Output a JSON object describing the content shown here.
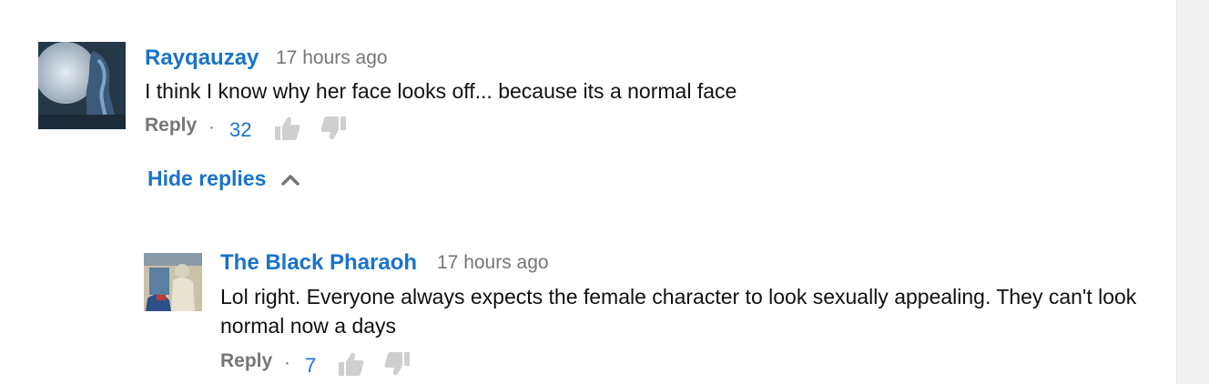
{
  "comments": [
    {
      "author": "Rayqauzay",
      "time": "17 hours ago",
      "text": "I think I know why her face looks off... because its a normal face",
      "reply_label": "Reply",
      "separator": "·",
      "likes": "32"
    }
  ],
  "replies_toggle": {
    "label": "Hide replies",
    "icon": "chevron-up-icon"
  },
  "replies": [
    {
      "author": "The Black Pharaoh",
      "time": "17 hours ago",
      "text": "Lol right. Everyone always expects the female character to look sexually appealing. They can't look normal now a days",
      "reply_label": "Reply",
      "separator": "·",
      "likes": "7"
    }
  ],
  "colors": {
    "link_blue": "#1a73c8",
    "meta_gray": "#767676",
    "thumb_gray": "#cfcfcf"
  },
  "icons": {
    "like": "thumbs-up-icon",
    "dislike": "thumbs-down-icon"
  }
}
